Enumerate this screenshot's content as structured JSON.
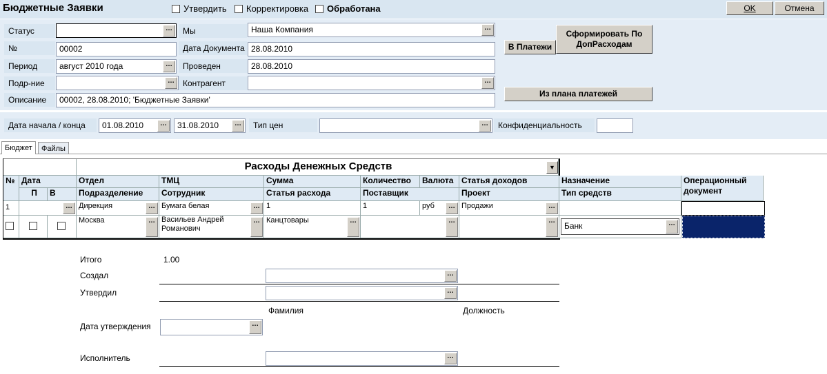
{
  "window": {
    "title": "Бюджетные Заявки",
    "ok_label": "OK",
    "cancel_label": "Отмена",
    "flags": [
      {
        "label": "Утвердить",
        "checked": false
      },
      {
        "label": "Корректировка",
        "checked": false
      },
      {
        "label": "Обработана",
        "checked": false
      }
    ]
  },
  "header": {
    "status_label": "Статус",
    "status_value": "",
    "number_label": "№",
    "number_value": "00002",
    "period_label": "Период",
    "period_value": "август 2010 года",
    "dept_label": "Подр-ние",
    "dept_value": "",
    "desc_label": "Описание",
    "desc_value": "00002, 28.08.2010; 'Бюджетные Заявки'",
    "we_label": "Мы",
    "we_value": "Наша Компания",
    "docdate_label": "Дата Документа",
    "docdate_value": "28.08.2010",
    "posted_label": "Проведен",
    "posted_value": "28.08.2010",
    "counterparty_label": "Контрагент",
    "counterparty_value": "",
    "to_payments_label": "В Платежи",
    "form_extra_label": "Сформировать По ДопРасходам",
    "from_plan_label": "Из плана платежей"
  },
  "period_bar": {
    "dates_label": "Дата начала / конца",
    "start": "01.08.2010",
    "end": "31.08.2010",
    "price_type_label": "Тип цен",
    "price_type_value": "",
    "confidential_label": "Конфиденциальность",
    "confidential_value": ""
  },
  "tabs": [
    {
      "label": "Бюджет",
      "active": true
    },
    {
      "label": "Файлы",
      "active": false
    }
  ],
  "grid": {
    "section_title": "Расходы Денежных Средств",
    "headers": {
      "no": "№",
      "date": "Дата",
      "p": "П",
      "v": "В",
      "dept": "Отдел",
      "subdivision": "Подразделение",
      "tmc": "ТМЦ",
      "employee": "Сотрудник",
      "sum": "Сумма",
      "expense_item": "Статья расхода",
      "qty": "Количество",
      "supplier": "Поставщик",
      "currency": "Валюта",
      "income_item": "Статья доходов",
      "project": "Проект",
      "purpose": "Назначение",
      "fund_type": "Тип средств",
      "op_doc": "Операционный документ"
    },
    "row": {
      "no": "1",
      "date": "",
      "dept": "Дирекция",
      "subdivision": "Москва",
      "tmc": "Бумага белая",
      "employee": "Васильев Андрей Романович",
      "sum": "1",
      "expense_item": "Канцтовары",
      "qty": "1",
      "supplier": "",
      "currency": "руб",
      "income_item": "Продажи",
      "project": "",
      "purpose": "",
      "fund_type": "Банк",
      "op_doc": ""
    }
  },
  "footer": {
    "total_label": "Итого",
    "total_value": "1.00",
    "created_label": "Создал",
    "approved_label": "Утвердил",
    "surname_label": "Фамилия",
    "position_label": "Должность",
    "approval_date_label": "Дата утверждения",
    "executor_label": "Исполнитель"
  },
  "colors": {
    "panel": "#d9e6f1",
    "selection": "#0a246a"
  },
  "icons": {
    "ellipsis": "…"
  }
}
